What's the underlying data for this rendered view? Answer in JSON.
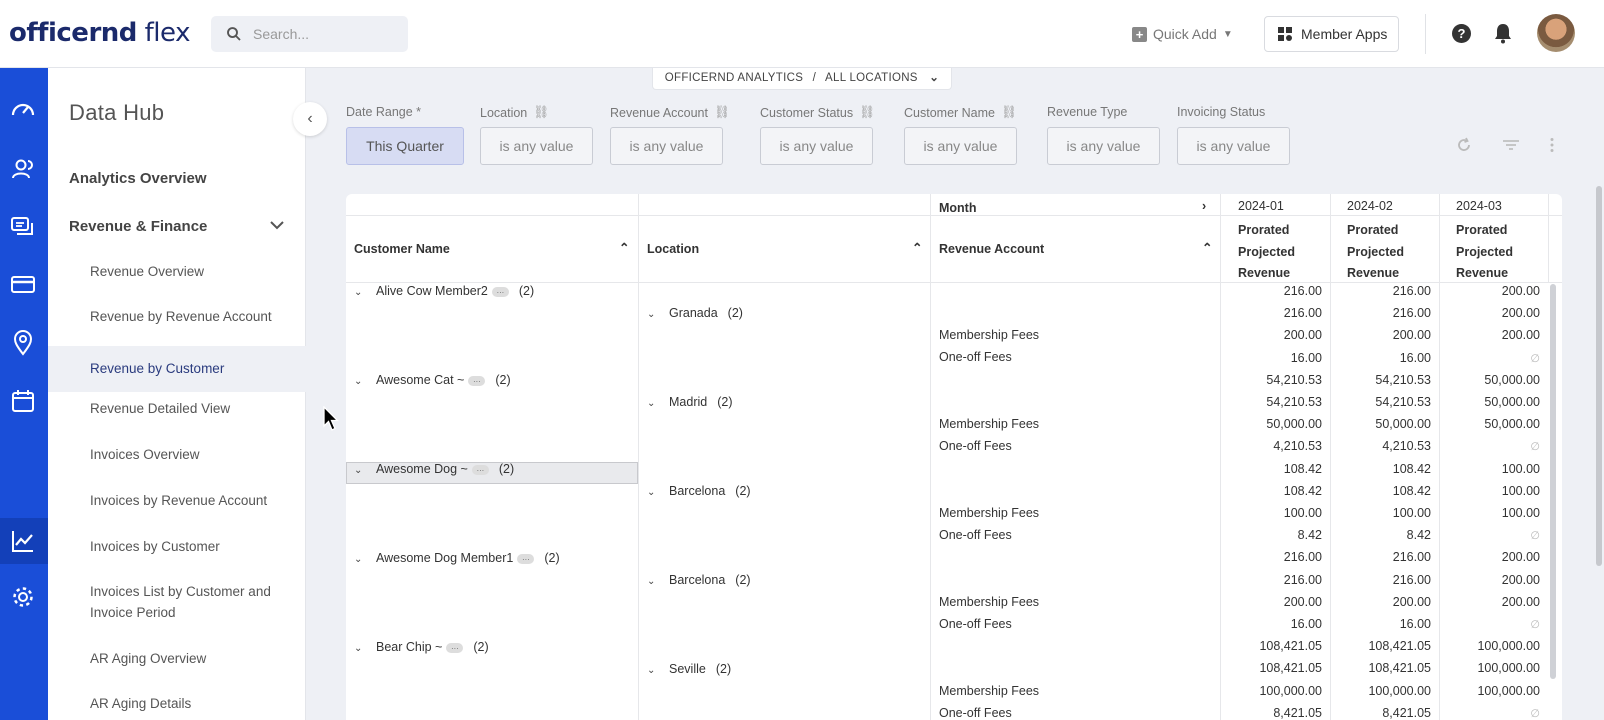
{
  "topbar": {
    "logo_bold": "officernd",
    "logo_light": " flex",
    "search_placeholder": "Search...",
    "quick_add": "Quick Add",
    "member_apps": "Member Apps",
    "help_glyph": "?"
  },
  "rail": {
    "icons": [
      "speedometer-icon",
      "users-icon",
      "chat-icon",
      "card-icon",
      "location-pin-icon",
      "calendar-icon",
      "analytics-chart-icon",
      "gear-icon"
    ],
    "active": "analytics-chart-icon",
    "background": "#1a4ed8"
  },
  "sidebar": {
    "title": "Data Hub",
    "sections": [
      {
        "label": "Analytics Overview"
      },
      {
        "label": "Revenue & Finance",
        "expanded": true
      }
    ],
    "items": [
      "Revenue Overview",
      "Revenue by Revenue Account",
      "Revenue by Customer",
      "Revenue Detailed View",
      "Invoices Overview",
      "Invoices by Revenue Account",
      "Invoices by Customer",
      "Invoices List by Customer and",
      "Invoice Period",
      "AR Aging Overview",
      "AR Aging Details"
    ],
    "selected": "Revenue by Customer"
  },
  "breadcrumb": {
    "part1": "OFFICERND ANALYTICS",
    "sep": "/",
    "part2": "ALL LOCATIONS"
  },
  "filters": [
    {
      "label": "Date Range *",
      "value": "This Quarter",
      "linked": false,
      "active": true
    },
    {
      "label": "Location",
      "value": "is any value",
      "linked": true
    },
    {
      "label": "Revenue Account",
      "value": "is any value",
      "linked": true
    },
    {
      "label": "Customer Status",
      "value": "is any value",
      "linked": true
    },
    {
      "label": "Customer Name",
      "value": "is any value",
      "linked": true
    },
    {
      "label": "Revenue Type",
      "value": "is any value",
      "linked": false
    },
    {
      "label": "Invoicing Status",
      "value": "is any value",
      "linked": false
    }
  ],
  "table": {
    "pivot_label": "Month",
    "months": [
      "2024-01",
      "2024-02",
      "2024-03"
    ],
    "measure": [
      "Prorated",
      "Projected",
      "Revenue"
    ],
    "columns": [
      "Customer Name",
      "Location",
      "Revenue Account"
    ],
    "customers": [
      {
        "name": "Alive Cow Member2",
        "count": "(2)"
      },
      {
        "name": "Awesome Cat ~",
        "count": "(2)"
      },
      {
        "name": "Awesome Dog ~",
        "count": "(2)"
      },
      {
        "name": "Awesome Dog Member1",
        "count": "(2)"
      },
      {
        "name": "Bear Chip ~",
        "count": "(2)"
      }
    ],
    "locations": [
      {
        "name": "Granada",
        "count": "(2)"
      },
      {
        "name": "Madrid",
        "count": "(2)"
      },
      {
        "name": "Barcelona",
        "count": "(2)"
      },
      {
        "name": "Barcelona",
        "count": "(2)"
      },
      {
        "name": "Seville",
        "count": "(2)"
      }
    ],
    "account_labels": [
      "Membership Fees",
      "One-off Fees"
    ],
    "rows": [
      [
        "216.00",
        "216.00",
        "200.00"
      ],
      [
        "216.00",
        "216.00",
        "200.00"
      ],
      [
        "200.00",
        "200.00",
        "200.00"
      ],
      [
        "16.00",
        "16.00",
        "∅"
      ],
      [
        "54,210.53",
        "54,210.53",
        "50,000.00"
      ],
      [
        "54,210.53",
        "54,210.53",
        "50,000.00"
      ],
      [
        "50,000.00",
        "50,000.00",
        "50,000.00"
      ],
      [
        "4,210.53",
        "4,210.53",
        "∅"
      ],
      [
        "108.42",
        "108.42",
        "100.00"
      ],
      [
        "108.42",
        "108.42",
        "100.00"
      ],
      [
        "100.00",
        "100.00",
        "100.00"
      ],
      [
        "8.42",
        "8.42",
        "∅"
      ],
      [
        "216.00",
        "216.00",
        "200.00"
      ],
      [
        "216.00",
        "216.00",
        "200.00"
      ],
      [
        "200.00",
        "200.00",
        "200.00"
      ],
      [
        "16.00",
        "16.00",
        "∅"
      ],
      [
        "108,421.05",
        "108,421.05",
        "100,000.00"
      ],
      [
        "108,421.05",
        "108,421.05",
        "100,000.00"
      ],
      [
        "100,000.00",
        "100,000.00",
        "100,000.00"
      ],
      [
        "8,421.05",
        "8,421.05",
        "∅"
      ]
    ]
  },
  "colors": {
    "accent": "#1a4ed8",
    "selected_filter": "#d7dcf3",
    "logo": "#1b2a6b"
  }
}
